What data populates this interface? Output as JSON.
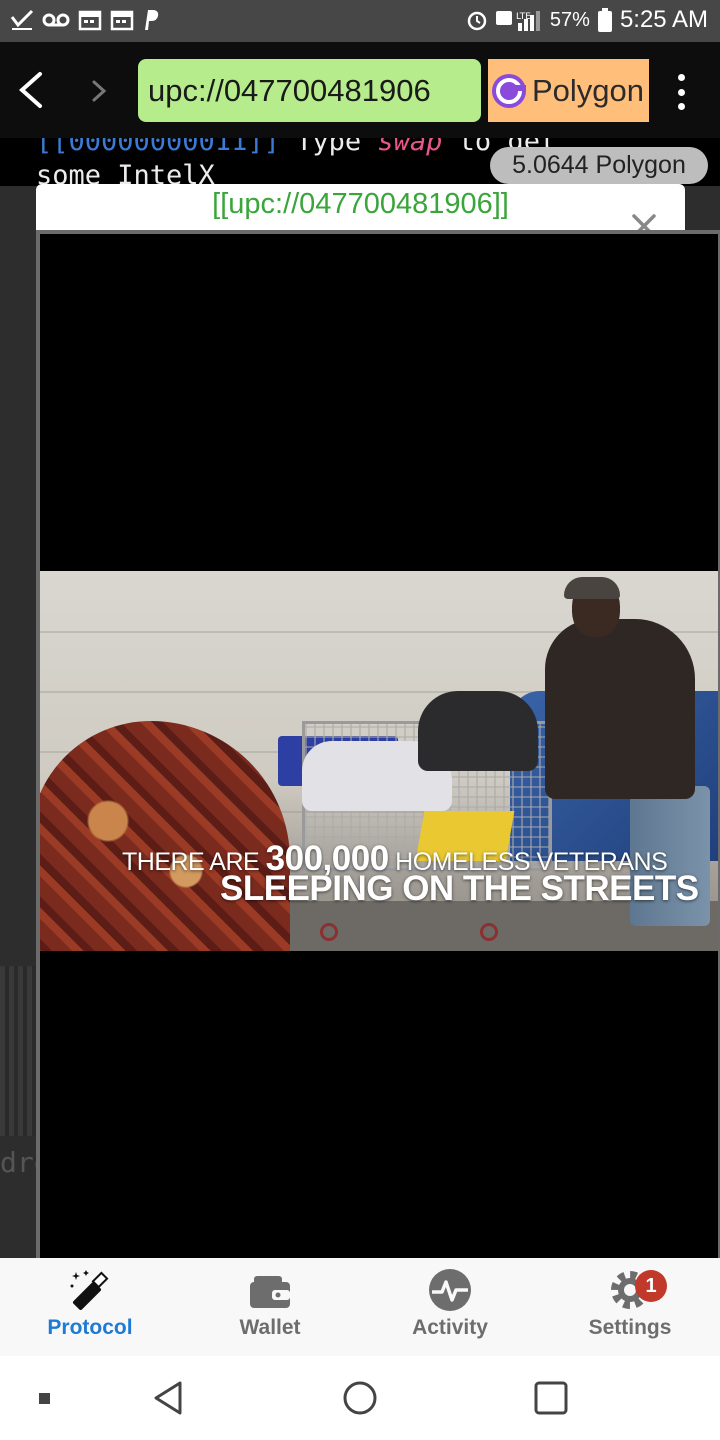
{
  "status_bar": {
    "left_icons": [
      "check-icon",
      "voicemail-icon",
      "calendar-icon",
      "calendar-icon",
      "paypal-icon"
    ],
    "right_icons": [
      "alarm-icon",
      "hd-lte-icon",
      "signal-icon",
      "battery-icon"
    ],
    "battery_percent": "57%",
    "time": "5:25 AM",
    "network_badge": "LTE"
  },
  "browser": {
    "url": "upc://047700481906",
    "network_label": "Polygon",
    "network_icon": "polygon-icon"
  },
  "terminal": {
    "line1_link": "[[00000000011]]",
    "line1_text1": " Type ",
    "line1_cmd": "swap",
    "line1_text2": " to get",
    "line2": "some IntelX",
    "side_fragment": "dre"
  },
  "balance": "5.0644 Polygon",
  "modal": {
    "title": "[[upc://047700481906]]"
  },
  "image": {
    "caption_line1_pre": "THERE ARE ",
    "caption_line1_number": "300,000",
    "caption_line1_post": " HOMELESS VETERANS",
    "caption_line2": "SLEEPING ON THE STREETS"
  },
  "tabs": [
    {
      "label": "Protocol",
      "icon": "magic-wand-icon",
      "active": true
    },
    {
      "label": "Wallet",
      "icon": "wallet-icon",
      "active": false
    },
    {
      "label": "Activity",
      "icon": "activity-icon",
      "active": false
    },
    {
      "label": "Settings",
      "icon": "gear-icon",
      "active": false,
      "badge": "1"
    }
  ],
  "colors": {
    "url_bg": "#b6ec8c",
    "network_bg": "#ffbe7a",
    "active_tab": "#1f7ad4",
    "modal_title": "#3aa53a",
    "badge": "#c0392b"
  }
}
